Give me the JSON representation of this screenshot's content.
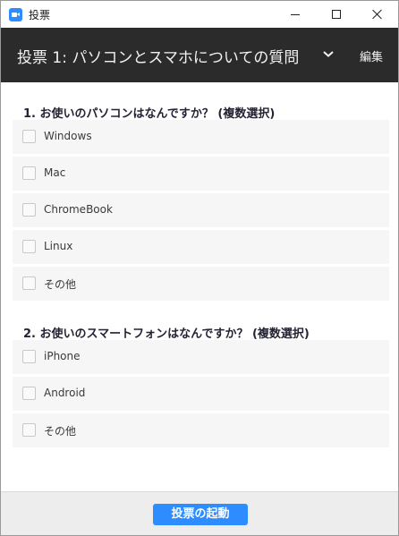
{
  "window": {
    "title": "投票",
    "controls": [
      "minimize-icon",
      "maximize-icon",
      "close-icon"
    ]
  },
  "header": {
    "title": "投票 1: パソコンとスマホについての質問",
    "dropdown_icon": "chevron-down-icon",
    "edit_label": "編集"
  },
  "questions": [
    {
      "title": "1. お使いのパソコンはなんですか？ (複数選択)",
      "options": [
        "Windows",
        "Mac",
        "ChromeBook",
        "Linux",
        "その他"
      ]
    },
    {
      "title": "2. お使いのスマートフォンはなんですか？ (複数選択)",
      "options": [
        "iPhone",
        "Android",
        "その他"
      ]
    }
  ],
  "footer": {
    "launch_label": "投票の起動"
  },
  "colors": {
    "accent": "#2d8cff",
    "header_bg": "#2b2b2b",
    "option_bg": "#f6f6f6"
  }
}
